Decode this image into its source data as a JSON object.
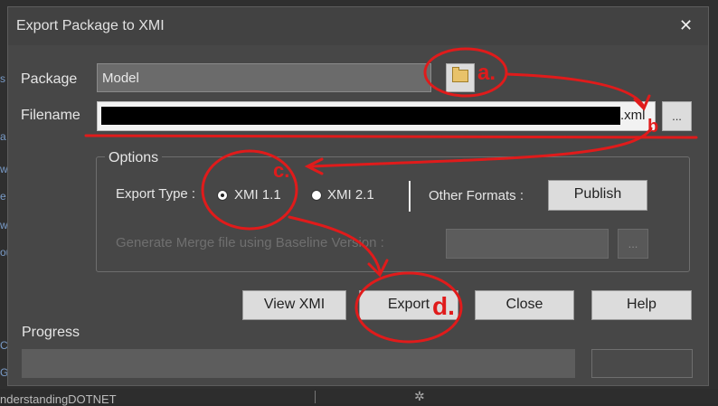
{
  "dialog": {
    "title": "Export Package to XMI",
    "close_glyph": "✕",
    "package": {
      "label": "Package",
      "value": "Model",
      "browse_icon": "folder-icon"
    },
    "filename": {
      "label": "Filename",
      "extension": ".xml",
      "browse_label": "..."
    },
    "options": {
      "title": "Options",
      "export_type_label": "Export Type :",
      "radios": [
        {
          "label": "XMI 1.1",
          "checked": true
        },
        {
          "label": "XMI 2.1",
          "checked": false
        }
      ],
      "other_formats_label": "Other Formats :",
      "publish_label": "Publish",
      "merge_label": "Generate Merge file using Baseline Version :",
      "merge_browse_label": "..."
    },
    "buttons": {
      "view_xmi": "View XMI",
      "export": "Export",
      "close": "Close",
      "help": "Help"
    },
    "progress": {
      "label": "Progress",
      "value": 0
    }
  },
  "background": {
    "bottom_text": "nderstandingDOTNET",
    "left_glyphs": [
      "s",
      "a",
      "w",
      "e",
      "w",
      "ou",
      "C",
      "G"
    ],
    "gear_glyph": "✲"
  },
  "annotations": {
    "color": "#e01b1b",
    "labels": [
      "a.",
      "b",
      "c.",
      "d."
    ]
  }
}
